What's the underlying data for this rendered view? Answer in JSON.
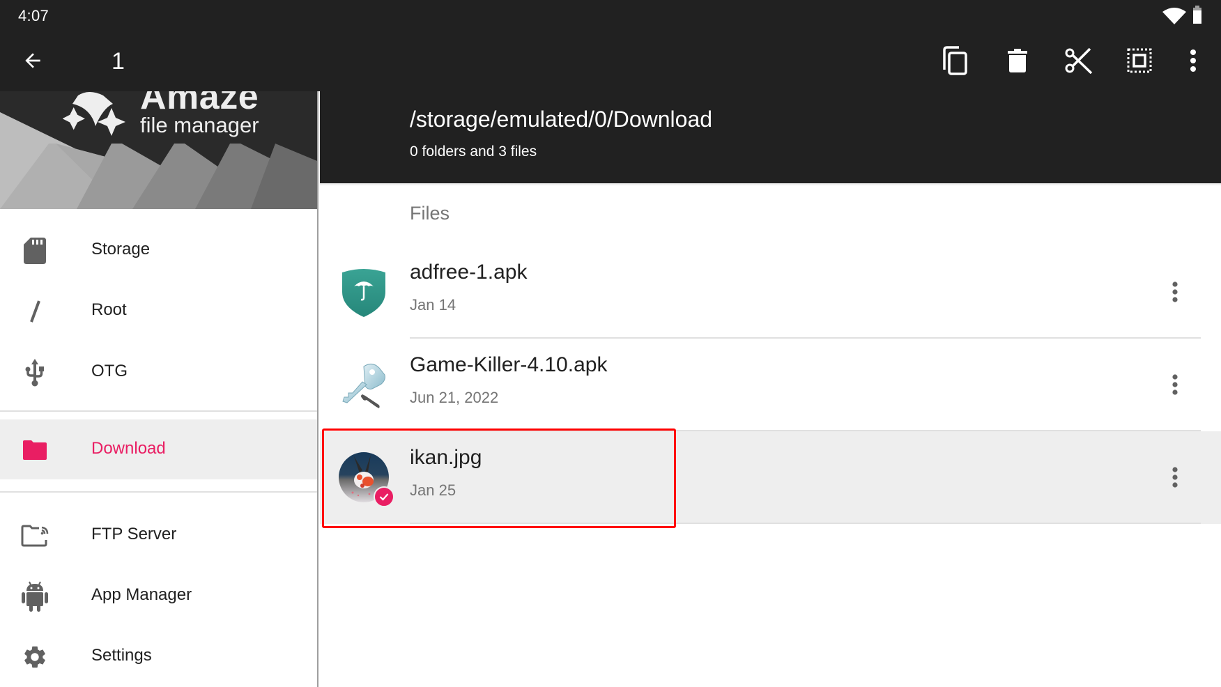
{
  "status_bar": {
    "time": "4:07",
    "icons": [
      "wifi-icon",
      "battery-icon"
    ]
  },
  "toolbar": {
    "back_icon": "arrow-back-icon",
    "selection_count": "1",
    "actions": [
      {
        "name": "copy",
        "icon": "copy-icon"
      },
      {
        "name": "delete",
        "icon": "delete-icon"
      },
      {
        "name": "cut",
        "icon": "cut-icon"
      },
      {
        "name": "select-all",
        "icon": "select-all-icon"
      },
      {
        "name": "more",
        "icon": "more-vert-icon"
      }
    ]
  },
  "drawer": {
    "logo_title": "Amaze",
    "logo_subtitle": "file manager",
    "items": [
      {
        "label": "Storage",
        "icon": "sd-card-icon",
        "active": false
      },
      {
        "label": "Root",
        "icon": "slash-icon",
        "active": false
      },
      {
        "label": "OTG",
        "icon": "usb-icon",
        "active": false
      },
      {
        "label": "Download",
        "icon": "folder-icon",
        "active": true
      },
      {
        "label": "FTP Server",
        "icon": "ftp-folder-icon",
        "active": false
      },
      {
        "label": "App Manager",
        "icon": "android-icon",
        "active": false
      },
      {
        "label": "Settings",
        "icon": "gear-icon",
        "active": false
      }
    ]
  },
  "main": {
    "path": "/storage/emulated/0/Download",
    "summary": "0 folders and 3 files",
    "section_label": "Files",
    "files": [
      {
        "name": "adfree-1.apk",
        "date": "Jan 14",
        "icon": "adfree-shield-icon",
        "selected": false
      },
      {
        "name": "Game-Killer-4.10.apk",
        "date": "Jun 21, 2022",
        "icon": "key-wrench-icon",
        "selected": false
      },
      {
        "name": "ikan.jpg",
        "date": "Jan 25",
        "icon": "image-thumbnail",
        "selected": true
      }
    ]
  },
  "colors": {
    "accent": "#e91e63",
    "appbar": "#212121",
    "selected_row": "#eeeeee",
    "highlight_box": "#ff0000"
  }
}
